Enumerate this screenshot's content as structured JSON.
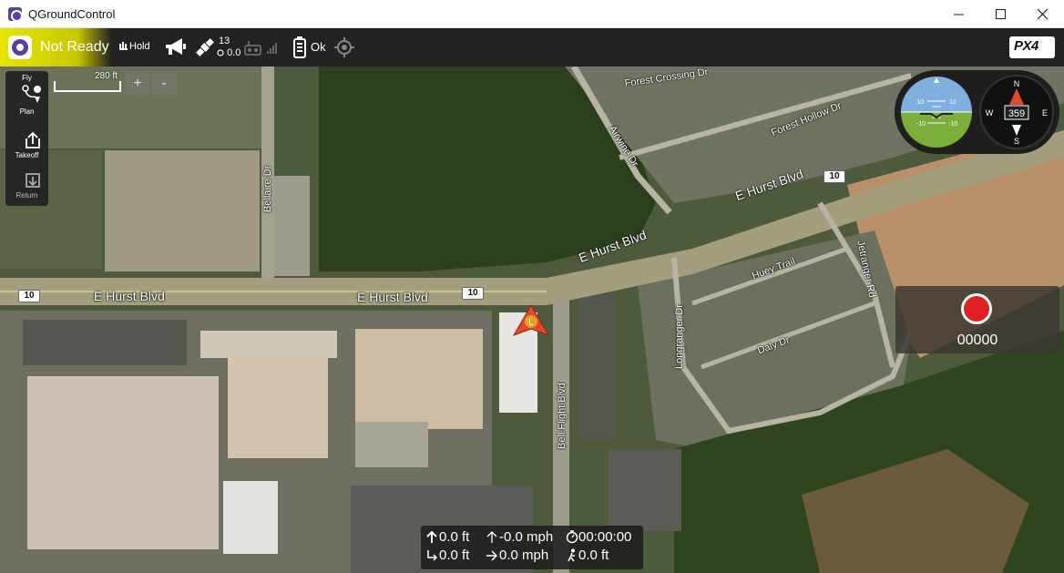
{
  "window": {
    "title": "QGroundControl",
    "controls": {
      "minimize": "minimize-icon",
      "maximize": "maximize-icon",
      "close": "close-icon"
    }
  },
  "toolbar": {
    "status": "Not Ready",
    "status_color": "#e6e600",
    "flight_mode": "Hold",
    "satellites": "13",
    "hdop": "0.0",
    "battery": "Ok",
    "logo": "PX4"
  },
  "toolstrip": {
    "items": [
      {
        "label": "Fly",
        "icon": "fly-icon"
      },
      {
        "label": "Plan",
        "icon": "plan-icon"
      },
      {
        "label": "Takeoff",
        "icon": "takeoff-icon"
      },
      {
        "label": "Return",
        "icon": "return-icon"
      }
    ]
  },
  "map": {
    "scale": "280 ft",
    "zoom_in": "+",
    "zoom_out": "-",
    "vehicle_label": "L",
    "streets": {
      "hurst_1": "E Hurst Blvd",
      "hurst_2": "E Hurst Blvd",
      "hurst_3": "E Hurst Blvd",
      "hurst_4": "E Hurst Blvd",
      "route_1": "10",
      "route_2": "10",
      "route_3": "10",
      "bellaire": "Bellaire Dr",
      "bell_flight": "Bell Flight Blvd",
      "forest_crossing": "Forest Crossing Dr",
      "forest_hollow": "Forest Hollow Dr",
      "airwine": "Airwine Dr",
      "huey": "Huey Trail",
      "jetranger": "Jetranger Rd",
      "longranger": "Longranger Dr",
      "daly": "Daly Dr"
    }
  },
  "instruments": {
    "heading": "359",
    "compass": {
      "n": "N",
      "e": "E",
      "s": "S",
      "w": "W"
    },
    "pitch_marks": [
      "10",
      "10",
      "-10",
      "-10"
    ]
  },
  "video": {
    "record_count": "00000",
    "record_color": "#e02020"
  },
  "telemetry": {
    "altitude": "0.0 ft",
    "vertical_speed": "-0.0 mph",
    "flight_time": "00:00:00",
    "distance_home": "0.0 ft",
    "ground_speed": "0.0 mph",
    "distance_gps": "0.0 ft"
  }
}
